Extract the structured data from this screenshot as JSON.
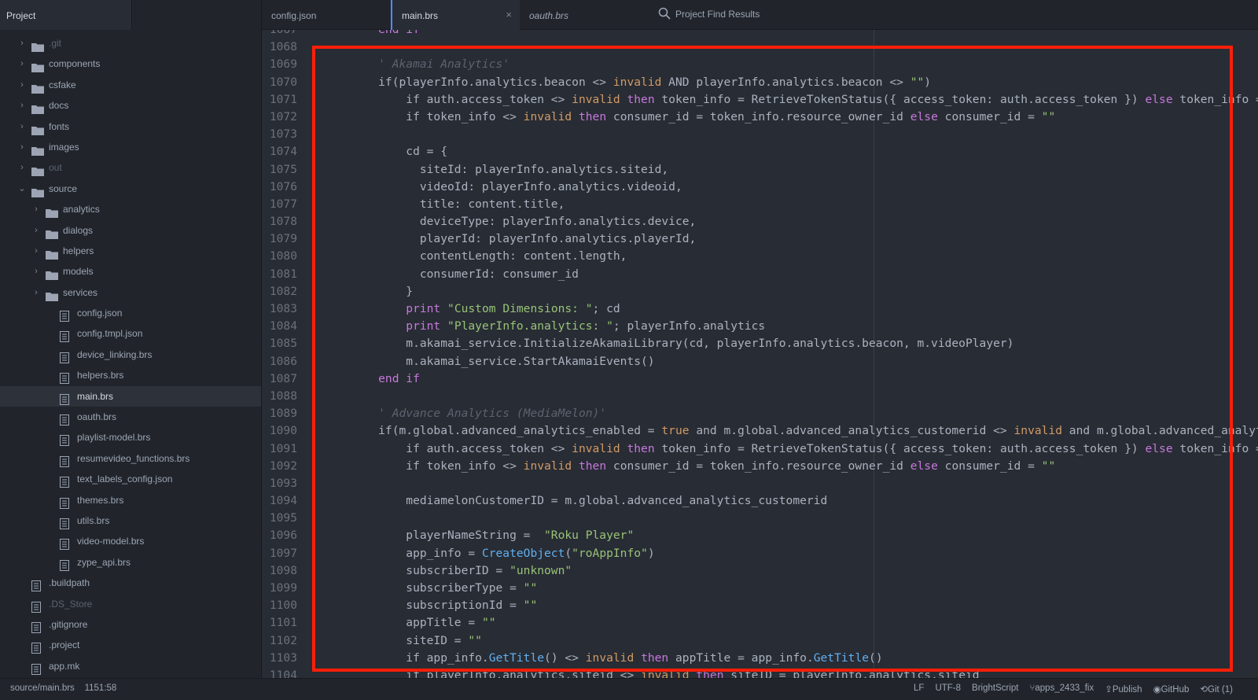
{
  "sidebar": {
    "title": "Project",
    "items": [
      {
        "label": ".git",
        "type": "folder",
        "depth": 0,
        "expanded": false,
        "dim": true
      },
      {
        "label": "components",
        "type": "folder",
        "depth": 0,
        "expanded": false
      },
      {
        "label": "csfake",
        "type": "folder",
        "depth": 0,
        "expanded": false
      },
      {
        "label": "docs",
        "type": "folder",
        "depth": 0,
        "expanded": false
      },
      {
        "label": "fonts",
        "type": "folder",
        "depth": 0,
        "expanded": false
      },
      {
        "label": "images",
        "type": "folder",
        "depth": 0,
        "expanded": false
      },
      {
        "label": "out",
        "type": "folder",
        "depth": 0,
        "expanded": false,
        "dim": true
      },
      {
        "label": "source",
        "type": "folder",
        "depth": 0,
        "expanded": true
      },
      {
        "label": "analytics",
        "type": "folder",
        "depth": 1,
        "expanded": false
      },
      {
        "label": "dialogs",
        "type": "folder",
        "depth": 1,
        "expanded": false
      },
      {
        "label": "helpers",
        "type": "folder",
        "depth": 1,
        "expanded": false
      },
      {
        "label": "models",
        "type": "folder",
        "depth": 1,
        "expanded": false
      },
      {
        "label": "services",
        "type": "folder",
        "depth": 1,
        "expanded": false
      },
      {
        "label": "config.json",
        "type": "file",
        "depth": 1
      },
      {
        "label": "config.tmpl.json",
        "type": "file",
        "depth": 1
      },
      {
        "label": "device_linking.brs",
        "type": "file",
        "depth": 1
      },
      {
        "label": "helpers.brs",
        "type": "file",
        "depth": 1
      },
      {
        "label": "main.brs",
        "type": "file",
        "depth": 1,
        "selected": true
      },
      {
        "label": "oauth.brs",
        "type": "file",
        "depth": 1
      },
      {
        "label": "playlist-model.brs",
        "type": "file",
        "depth": 1
      },
      {
        "label": "resumevideo_functions.brs",
        "type": "file",
        "depth": 1
      },
      {
        "label": "text_labels_config.json",
        "type": "file",
        "depth": 1
      },
      {
        "label": "themes.brs",
        "type": "file",
        "depth": 1
      },
      {
        "label": "utils.brs",
        "type": "file",
        "depth": 1
      },
      {
        "label": "video-model.brs",
        "type": "file",
        "depth": 1
      },
      {
        "label": "zype_api.brs",
        "type": "file",
        "depth": 1
      },
      {
        "label": ".buildpath",
        "type": "file",
        "depth": 0
      },
      {
        "label": ".DS_Store",
        "type": "file",
        "depth": 0,
        "dim": true
      },
      {
        "label": ".gitignore",
        "type": "file",
        "depth": 0
      },
      {
        "label": ".project",
        "type": "file",
        "depth": 0
      },
      {
        "label": "app.mk",
        "type": "file",
        "depth": 0
      }
    ]
  },
  "tabs": [
    {
      "label": "config.json",
      "active": false,
      "italic": false
    },
    {
      "label": "main.brs",
      "active": true,
      "italic": false,
      "close": "×"
    },
    {
      "label": "oauth.brs",
      "active": false,
      "italic": true
    },
    {
      "label": "Project Find Results",
      "active": false,
      "italic": false,
      "icon": "search-icon"
    }
  ],
  "editor": {
    "first_line": 1067,
    "lines": [
      [
        [
          "kw2",
          "    end if"
        ]
      ],
      [],
      [
        [
          "cm",
          "    ' Akamai Analytics'"
        ]
      ],
      [
        [
          "nm",
          "    if(playerInfo.analytics.beacon <> "
        ],
        [
          "kw",
          "invalid"
        ],
        [
          "nm",
          " AND playerInfo.analytics.beacon <> "
        ],
        [
          "str",
          "\"\""
        ],
        [
          "nm",
          ")"
        ]
      ],
      [
        [
          "nm",
          "        if auth.access_token <> "
        ],
        [
          "kw",
          "invalid"
        ],
        [
          "nm",
          " "
        ],
        [
          "kw2",
          "then"
        ],
        [
          "nm",
          " token_info = RetrieveTokenStatus({ access_token: auth.access_token }) "
        ],
        [
          "kw2",
          "else"
        ],
        [
          "nm",
          " token_info ="
        ]
      ],
      [
        [
          "nm",
          "        if token_info <> "
        ],
        [
          "kw",
          "invalid"
        ],
        [
          "nm",
          " "
        ],
        [
          "kw2",
          "then"
        ],
        [
          "nm",
          " consumer_id = token_info.resource_owner_id "
        ],
        [
          "kw2",
          "else"
        ],
        [
          "nm",
          " consumer_id = "
        ],
        [
          "str",
          "\"\""
        ]
      ],
      [],
      [
        [
          "nm",
          "        cd = {"
        ]
      ],
      [
        [
          "nm",
          "          siteId: playerInfo.analytics.siteid,"
        ]
      ],
      [
        [
          "nm",
          "          videoId: playerInfo.analytics.videoid,"
        ]
      ],
      [
        [
          "nm",
          "          title: content.title,"
        ]
      ],
      [
        [
          "nm",
          "          deviceType: playerInfo.analytics.device,"
        ]
      ],
      [
        [
          "nm",
          "          playerId: playerInfo.analytics.playerId,"
        ]
      ],
      [
        [
          "nm",
          "          contentLength: content.length,"
        ]
      ],
      [
        [
          "nm",
          "          consumerId: consumer_id"
        ]
      ],
      [
        [
          "nm",
          "        }"
        ]
      ],
      [
        [
          "kw2",
          "        print"
        ],
        [
          "nm",
          " "
        ],
        [
          "str",
          "\"Custom Dimensions: \""
        ],
        [
          "nm",
          "; cd"
        ]
      ],
      [
        [
          "kw2",
          "        print"
        ],
        [
          "nm",
          " "
        ],
        [
          "str",
          "\"PlayerInfo.analytics: \""
        ],
        [
          "nm",
          "; playerInfo.analytics"
        ]
      ],
      [
        [
          "nm",
          "        m.akamai_service.InitializeAkamaiLibrary(cd, playerInfo.analytics.beacon, m.videoPlayer)"
        ]
      ],
      [
        [
          "nm",
          "        m.akamai_service.StartAkamaiEvents()"
        ]
      ],
      [
        [
          "kw2",
          "    end if"
        ]
      ],
      [],
      [
        [
          "cm",
          "    ' Advance Analytics (MediaMelon)'"
        ]
      ],
      [
        [
          "nm",
          "    if(m.global.advanced_analytics_enabled = "
        ],
        [
          "kw",
          "true"
        ],
        [
          "nm",
          " and m.global.advanced_analytics_customerid <> "
        ],
        [
          "kw",
          "invalid"
        ],
        [
          "nm",
          " and m.global.advanced_analyt"
        ]
      ],
      [
        [
          "nm",
          "        if auth.access_token <> "
        ],
        [
          "kw",
          "invalid"
        ],
        [
          "nm",
          " "
        ],
        [
          "kw2",
          "then"
        ],
        [
          "nm",
          " token_info = RetrieveTokenStatus({ access_token: auth.access_token }) "
        ],
        [
          "kw2",
          "else"
        ],
        [
          "nm",
          " token_info ="
        ]
      ],
      [
        [
          "nm",
          "        if token_info <> "
        ],
        [
          "kw",
          "invalid"
        ],
        [
          "nm",
          " "
        ],
        [
          "kw2",
          "then"
        ],
        [
          "nm",
          " consumer_id = token_info.resource_owner_id "
        ],
        [
          "kw2",
          "else"
        ],
        [
          "nm",
          " consumer_id = "
        ],
        [
          "str",
          "\"\""
        ]
      ],
      [],
      [
        [
          "nm",
          "        mediamelonCustomerID = m.global.advanced_analytics_customerid"
        ]
      ],
      [],
      [
        [
          "nm",
          "        playerNameString =  "
        ],
        [
          "str",
          "\"Roku Player\""
        ]
      ],
      [
        [
          "nm",
          "        app_info = "
        ],
        [
          "fn",
          "CreateObject"
        ],
        [
          "nm",
          "("
        ],
        [
          "str",
          "\"roAppInfo\""
        ],
        [
          "nm",
          ")"
        ]
      ],
      [
        [
          "nm",
          "        subscriberID = "
        ],
        [
          "str",
          "\"unknown\""
        ]
      ],
      [
        [
          "nm",
          "        subscriberType = "
        ],
        [
          "str",
          "\"\""
        ]
      ],
      [
        [
          "nm",
          "        subscriptionId = "
        ],
        [
          "str",
          "\"\""
        ]
      ],
      [
        [
          "nm",
          "        appTitle = "
        ],
        [
          "str",
          "\"\""
        ]
      ],
      [
        [
          "nm",
          "        siteID = "
        ],
        [
          "str",
          "\"\""
        ]
      ],
      [
        [
          "nm",
          "        if app_info."
        ],
        [
          "fn",
          "GetTitle"
        ],
        [
          "nm",
          "() <> "
        ],
        [
          "kw",
          "invalid"
        ],
        [
          "nm",
          " "
        ],
        [
          "kw2",
          "then"
        ],
        [
          "nm",
          " appTitle = app_info."
        ],
        [
          "fn",
          "GetTitle"
        ],
        [
          "nm",
          "()"
        ]
      ],
      [
        [
          "nm",
          "        if playerInfo.analytics.siteid <> "
        ],
        [
          "kw",
          "invalid"
        ],
        [
          "nm",
          " "
        ],
        [
          "kw2",
          "then"
        ],
        [
          "nm",
          " siteID = playerInfo.analytics.siteid"
        ]
      ]
    ]
  },
  "status": {
    "path": "source/main.brs",
    "cursor": "1151:58",
    "line_ending": "LF",
    "encoding": "UTF-8",
    "grammar": "BrightScript",
    "branch": "apps_2433_fix",
    "publish": "Publish",
    "github": "GitHub",
    "git": "Git (1)"
  },
  "colors": {
    "highlight_box": "#ff1f08",
    "accent": "#528bff"
  }
}
